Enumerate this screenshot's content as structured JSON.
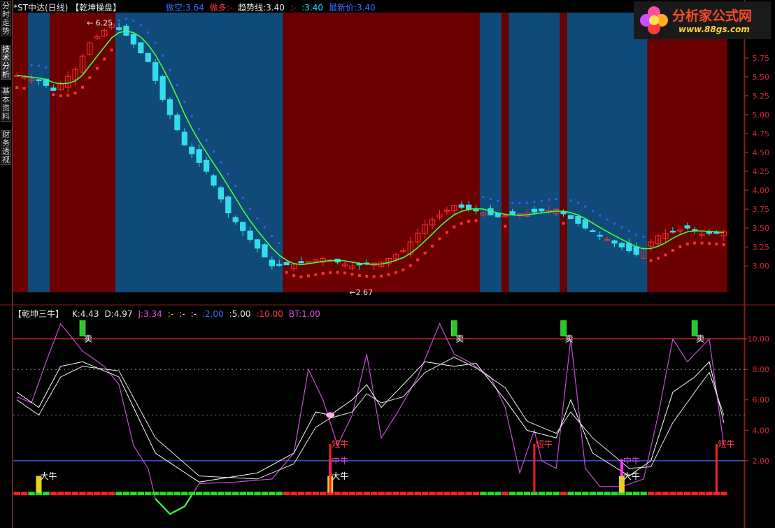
{
  "left_tabs": [
    {
      "label": "分时走势",
      "active": false
    },
    {
      "label": "技术分析",
      "active": true
    },
    {
      "label": "基本资料",
      "active": false
    },
    {
      "label": "财务透视",
      "active": false
    }
  ],
  "main_header": {
    "stock": "*ST中达(日线)",
    "indicator": "【乾坤操盘】",
    "items": [
      {
        "label": "做空:3.64",
        "color": "#3a6bff"
      },
      {
        "label": "做多:-",
        "color": "#ff3a3a"
      },
      {
        "label": "趋势线:3.40",
        "color": "#e6e6e6"
      },
      {
        "label": ":-",
        "color": "#ff3a3a"
      },
      {
        "label": ":3.40",
        "color": "#00e5ff"
      },
      {
        "label": "最新价:3.40",
        "color": "#3a6bff"
      }
    ]
  },
  "sub_header": {
    "indicator": "【乾坤三牛】",
    "items": [
      {
        "label": "K:4.43",
        "color": "#e6e6e6"
      },
      {
        "label": "D:4.97",
        "color": "#e6e6e6"
      },
      {
        "label": "J:3.34",
        "color": "#e050e0"
      },
      {
        "label": ":-",
        "color": "#ffe14a"
      },
      {
        "label": ":-",
        "color": "#e6e6e6"
      },
      {
        "label": ":-",
        "color": "#e6e6e6"
      },
      {
        "label": ":2.00",
        "color": "#3a6bff"
      },
      {
        "label": ":5.00",
        "color": "#e6e6e6"
      },
      {
        "label": ":10.00",
        "color": "#ff3a3a"
      },
      {
        "label": "BT:1.00",
        "color": "#e050e0"
      }
    ]
  },
  "logo": {
    "title": "分析家公式网",
    "url": "www.88gs.com"
  },
  "annotations": {
    "high": "6.25",
    "low": "2.67"
  },
  "signals": {
    "sell": "卖",
    "big_bull": "大牛",
    "mid_bull": "中牛",
    "short_bull": "短牛"
  },
  "colors": {
    "up": "#ff3030",
    "down": "#33ddee",
    "bg_red": "#6b0000",
    "bg_blue": "#0f4a78",
    "trend": "#40ff40"
  },
  "chart_data": [
    {
      "type": "candlestick",
      "title": "*ST中达(日线)",
      "y_ticks": [
        3.0,
        3.25,
        3.5,
        3.75,
        4.0,
        4.25,
        4.5,
        4.75,
        5.0,
        5.25,
        5.5,
        5.75
      ],
      "ylim": [
        2.65,
        6.35
      ],
      "num_bars": 98,
      "regimes": [
        {
          "from": 0,
          "to": 1,
          "state": "bull"
        },
        {
          "from": 2,
          "to": 4,
          "state": "bear"
        },
        {
          "from": 5,
          "to": 13,
          "state": "bull"
        },
        {
          "from": 14,
          "to": 36,
          "state": "bear"
        },
        {
          "from": 37,
          "to": 63,
          "state": "bull"
        },
        {
          "from": 64,
          "to": 66,
          "state": "bear"
        },
        {
          "from": 67,
          "to": 67,
          "state": "bull"
        },
        {
          "from": 68,
          "to": 74,
          "state": "bear"
        },
        {
          "from": 75,
          "to": 75,
          "state": "bull"
        },
        {
          "from": 76,
          "to": 86,
          "state": "bear"
        },
        {
          "from": 87,
          "to": 97,
          "state": "bull"
        }
      ],
      "close_anchors": [
        [
          0,
          5.52
        ],
        [
          3,
          5.45
        ],
        [
          5,
          5.32
        ],
        [
          8,
          5.6
        ],
        [
          10,
          5.95
        ],
        [
          13,
          6.2
        ],
        [
          15,
          6.05
        ],
        [
          18,
          5.7
        ],
        [
          20,
          5.2
        ],
        [
          23,
          4.6
        ],
        [
          26,
          4.25
        ],
        [
          29,
          3.7
        ],
        [
          32,
          3.35
        ],
        [
          35,
          3.0
        ],
        [
          38,
          3.02
        ],
        [
          42,
          3.1
        ],
        [
          46,
          3.0
        ],
        [
          50,
          3.05
        ],
        [
          53,
          3.2
        ],
        [
          56,
          3.55
        ],
        [
          60,
          3.8
        ],
        [
          62,
          3.75
        ],
        [
          66,
          3.65
        ],
        [
          70,
          3.7
        ],
        [
          74,
          3.75
        ],
        [
          78,
          3.5
        ],
        [
          82,
          3.3
        ],
        [
          85,
          3.15
        ],
        [
          88,
          3.4
        ],
        [
          92,
          3.5
        ],
        [
          94,
          3.42
        ],
        [
          97,
          3.45
        ]
      ],
      "trend_line": {
        "name": "趋势线"
      },
      "short_stop": {
        "name": "做空"
      },
      "long_stop": {
        "name": "做多"
      }
    },
    {
      "type": "line",
      "title": "【乾坤三牛】",
      "y_ticks": [
        2.0,
        4.0,
        6.0,
        8.0,
        10.0
      ],
      "ylim": [
        -1.5,
        11.5
      ],
      "hlines": [
        {
          "y": 10,
          "color": "#ff3030"
        },
        {
          "y": 2,
          "color": "#5566ff"
        },
        {
          "y": 5,
          "style": "dotted"
        },
        {
          "y": 8,
          "style": "dotted"
        }
      ],
      "series": [
        {
          "name": "J",
          "anchors": [
            [
              0,
              6.2
            ],
            [
              2,
              5.8
            ],
            [
              4,
              8.5
            ],
            [
              6,
              11.0
            ],
            [
              9,
              9.2
            ],
            [
              12,
              8.2
            ],
            [
              14,
              7.0
            ],
            [
              16,
              3.0
            ],
            [
              18,
              1.5
            ],
            [
              19,
              -0.5
            ],
            [
              21,
              -1.5
            ],
            [
              23,
              -1.0
            ],
            [
              25,
              0.5
            ],
            [
              30,
              0.6
            ],
            [
              35,
              0.8
            ],
            [
              38,
              2.5
            ],
            [
              40,
              8.0
            ],
            [
              42,
              6.0
            ],
            [
              44,
              3.0
            ],
            [
              46,
              5.0
            ],
            [
              48,
              9.0
            ],
            [
              50,
              3.5
            ],
            [
              52,
              5.0
            ],
            [
              55,
              7.5
            ],
            [
              58,
              11.0
            ],
            [
              60,
              9.0
            ],
            [
              62,
              8.5
            ],
            [
              65,
              7.5
            ],
            [
              67,
              5.5
            ],
            [
              69,
              1.2
            ],
            [
              71,
              4.0
            ],
            [
              72,
              2.0
            ],
            [
              74,
              1.5
            ],
            [
              76,
              10.0
            ],
            [
              78,
              1.5
            ],
            [
              80,
              0.3
            ],
            [
              83,
              0.3
            ],
            [
              86,
              0.8
            ],
            [
              88,
              5.0
            ],
            [
              90,
              10.0
            ],
            [
              92,
              8.5
            ],
            [
              95,
              10.0
            ],
            [
              97,
              3.0
            ]
          ]
        },
        {
          "name": "K",
          "anchors": [
            [
              0,
              6.5
            ],
            [
              3,
              5.5
            ],
            [
              6,
              8.2
            ],
            [
              9,
              8.5
            ],
            [
              14,
              7.5
            ],
            [
              19,
              2.5
            ],
            [
              25,
              0.6
            ],
            [
              33,
              1.2
            ],
            [
              38,
              2.5
            ],
            [
              41,
              5.2
            ],
            [
              43,
              5.0
            ],
            [
              46,
              6.0
            ],
            [
              48,
              7.0
            ],
            [
              50,
              5.5
            ],
            [
              53,
              7.0
            ],
            [
              56,
              8.5
            ],
            [
              60,
              8.2
            ],
            [
              63,
              8.4
            ],
            [
              67,
              6.0
            ],
            [
              70,
              4.0
            ],
            [
              74,
              3.5
            ],
            [
              76,
              6.0
            ],
            [
              79,
              2.5
            ],
            [
              84,
              1.0
            ],
            [
              87,
              2.0
            ],
            [
              90,
              6.5
            ],
            [
              93,
              7.5
            ],
            [
              95,
              8.5
            ],
            [
              97,
              4.5
            ]
          ]
        },
        {
          "name": "D",
          "anchors": [
            [
              0,
              6.0
            ],
            [
              3,
              5.0
            ],
            [
              6,
              7.5
            ],
            [
              9,
              8.2
            ],
            [
              14,
              7.9
            ],
            [
              19,
              3.5
            ],
            [
              25,
              1.0
            ],
            [
              33,
              0.8
            ],
            [
              38,
              1.8
            ],
            [
              41,
              4.2
            ],
            [
              43,
              4.8
            ],
            [
              46,
              5.2
            ],
            [
              48,
              6.4
            ],
            [
              50,
              5.8
            ],
            [
              53,
              6.2
            ],
            [
              56,
              7.8
            ],
            [
              60,
              8.8
            ],
            [
              63,
              8.1
            ],
            [
              67,
              6.8
            ],
            [
              70,
              4.6
            ],
            [
              74,
              3.8
            ],
            [
              76,
              5.2
            ],
            [
              79,
              3.5
            ],
            [
              84,
              1.5
            ],
            [
              87,
              1.6
            ],
            [
              90,
              4.5
            ],
            [
              93,
              6.5
            ],
            [
              95,
              7.8
            ],
            [
              97,
              5.0
            ]
          ]
        }
      ],
      "markers": {
        "sell": [
          9,
          60,
          75,
          93
        ],
        "big_bull": [
          3,
          43,
          83
        ],
        "mid_bull": [
          43,
          83
        ],
        "short_bull": [
          43,
          71,
          96
        ],
        "pink_point": [
          43,
          5.0
        ]
      }
    }
  ]
}
